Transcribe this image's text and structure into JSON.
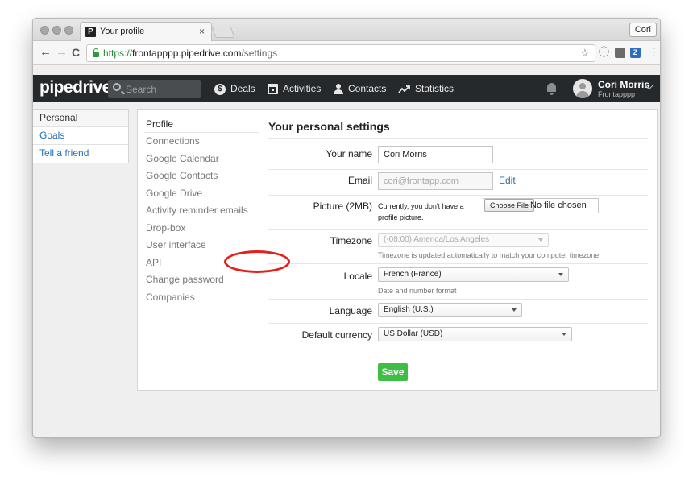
{
  "browser": {
    "tab_title": "Your profile",
    "tab_favicon": "P",
    "tab_close": "×",
    "profile_button": "Cori",
    "url_scheme": "https://",
    "url_host": "frontapppp.pipedrive.com",
    "url_path": "/settings",
    "nav_back": "←",
    "nav_forward": "→",
    "nav_reload": "C",
    "star": "☆",
    "ext_info": "ⓘ",
    "ext_z": "Z",
    "menu_dots": "⋮"
  },
  "appnav": {
    "brand": "pipedrive",
    "search_placeholder": "Search",
    "deals": "Deals",
    "deals_icon": "$",
    "activities": "Activities",
    "contacts": "Contacts",
    "statistics": "Statistics",
    "user_name": "Cori Morris",
    "user_company": "Frontapppp"
  },
  "leftnav": {
    "items": [
      {
        "label": "Personal"
      },
      {
        "label": "Goals"
      },
      {
        "label": "Tell a friend"
      }
    ]
  },
  "subnav": {
    "items": [
      {
        "label": "Profile"
      },
      {
        "label": "Connections"
      },
      {
        "label": "Google Calendar"
      },
      {
        "label": "Google Contacts"
      },
      {
        "label": "Google Drive"
      },
      {
        "label": "Activity reminder emails"
      },
      {
        "label": "Drop-box"
      },
      {
        "label": "User interface"
      },
      {
        "label": "API"
      },
      {
        "label": "Change password"
      },
      {
        "label": "Companies"
      }
    ]
  },
  "settings": {
    "heading": "Your personal settings",
    "name_label": "Your name",
    "name_value": "Cori Morris",
    "email_label": "Email",
    "email_value": "cori@frontapp.com",
    "email_edit": "Edit",
    "picture_label": "Picture (2MB)",
    "picture_note": "Currently, you don't have a profile picture.",
    "choose_file": "Choose File",
    "no_file": "No file chosen",
    "timezone_label": "Timezone",
    "timezone_value": "(-08:00) America/Los Angeles",
    "timezone_hint": "Timezone is updated automatically to match your computer timezone",
    "locale_label": "Locale",
    "locale_value": "French (France)",
    "locale_hint": "Date and number format",
    "language_label": "Language",
    "language_value": "English (U.S.)",
    "currency_label": "Default currency",
    "currency_value": "US Dollar (USD)",
    "save": "Save"
  },
  "colors": {
    "nav_bg": "#26292c",
    "link": "#1f70b8",
    "save_green": "#3fbe45",
    "annotation_red": "#e3201b"
  }
}
